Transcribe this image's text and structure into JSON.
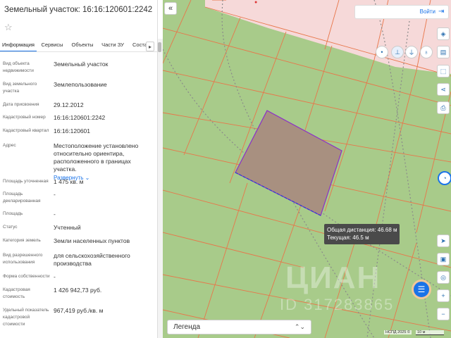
{
  "panel": {
    "title": "Земельный участок: 16:16:120601:2242",
    "tabs": [
      "Информация",
      "Сервисы",
      "Объекты",
      "Части ЗУ",
      "Состав"
    ],
    "fields": [
      {
        "label": "Вид объекта недвижимости",
        "value": "Земельный участок"
      },
      {
        "label": "Вид земельного участка",
        "value": "Землепользование"
      },
      {
        "label": "Дата присвоения",
        "value": "29.12.2012"
      },
      {
        "label": "Кадастровый номер",
        "value": "16:16:120601:2242"
      },
      {
        "label": "Кадастровый квартал",
        "value": "16:16:120601"
      },
      {
        "label": "Адрес",
        "value": "Местоположение установлено относительно ориентира, расположенного в границах участка.",
        "link": "Развернуть"
      },
      {
        "label": "Площадь уточненная",
        "value": "1 475 кв. м"
      },
      {
        "label": "Площадь декларированная",
        "value": "-"
      },
      {
        "label": "Площадь",
        "value": "-"
      },
      {
        "label": "Статус",
        "value": "Учтенный"
      },
      {
        "label": "Категория земель",
        "value": "Земли населенных пунктов"
      },
      {
        "label": "Вид разрешенного использования",
        "value": "для сельскохозяйственного производства"
      },
      {
        "label": "Форма собственности",
        "value": "-"
      },
      {
        "label": "Кадастровая стоимость",
        "value": "1 426 942,73 руб."
      },
      {
        "label": "Удельный показатель кадастровой стоимости",
        "value": "967,419 руб./кв. м"
      }
    ]
  },
  "map": {
    "search_button": "Войти",
    "measure": {
      "total": "Общая дистанция: 46.68 м",
      "current": "Текущая: 46.5 м"
    },
    "legend_label": "Легенда",
    "watermark": "ЦИАН",
    "watermark_id": "ID 317283865",
    "copyright": "НСПД 2025 ©",
    "scale": "10 м",
    "colors": {
      "land": "#a8cb8a",
      "parcel_border": "#e8764a",
      "selected_fill": "#a89080",
      "selected_border": "#8b2fc9",
      "built_area": "#f6d9d9",
      "accent": "#1a73e8"
    }
  }
}
